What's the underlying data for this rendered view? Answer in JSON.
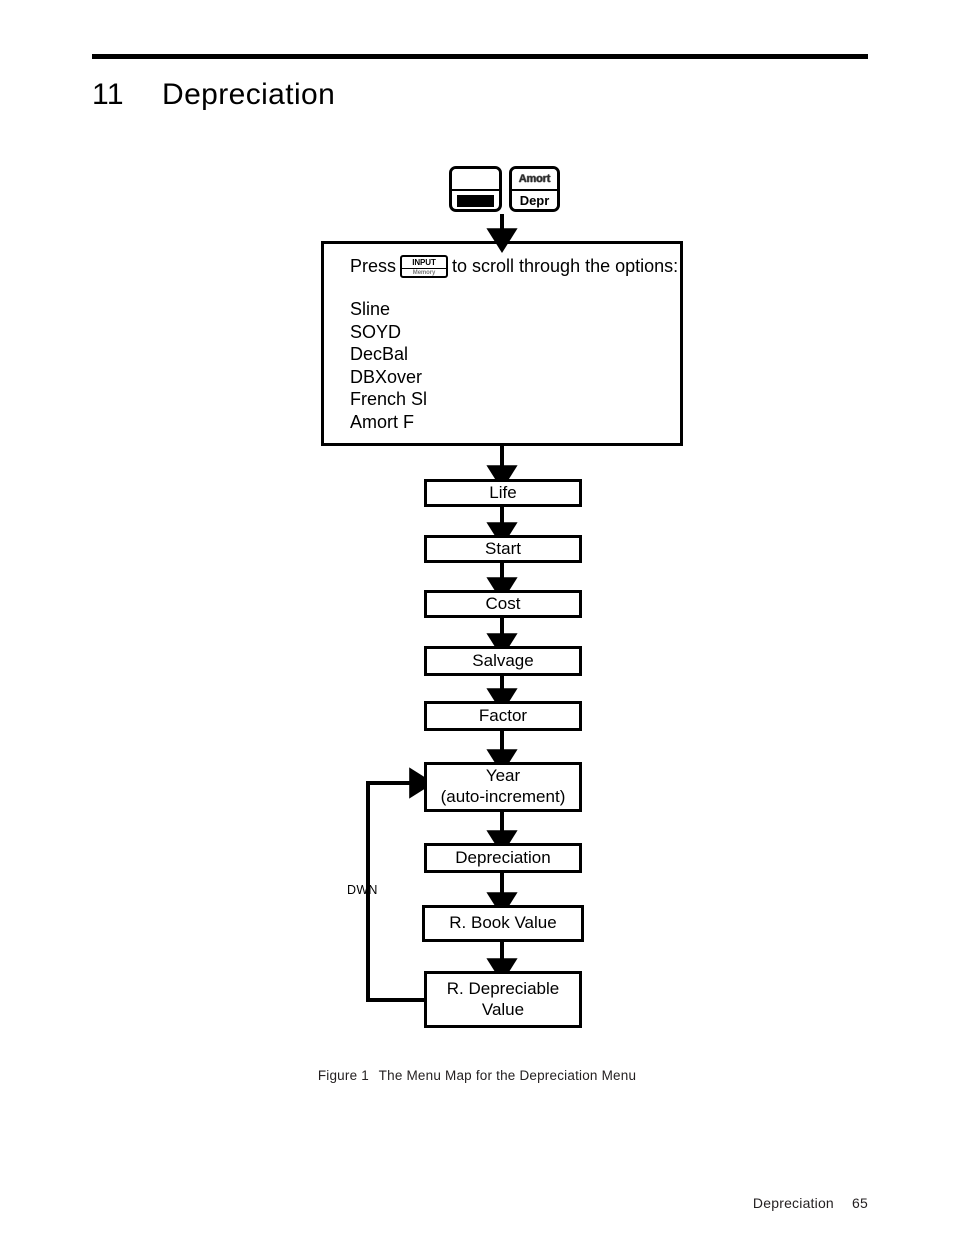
{
  "chapter": {
    "number": "11",
    "title": "Depreciation"
  },
  "keys": {
    "shift_key": {
      "name": "shift-key",
      "label": ""
    },
    "amort_depr_key": {
      "shifted_label": "Amort",
      "primary_label": "Depr"
    },
    "input_key": {
      "primary_label": "INPUT",
      "shifted_label": "Memory"
    }
  },
  "options_box": {
    "prompt_before": "Press",
    "prompt_after": "to scroll through the options:",
    "options": [
      "Sline",
      "SOYD",
      "DecBal",
      "DBXover",
      "French Sl",
      "Amort F"
    ]
  },
  "flow": {
    "boxes": [
      {
        "id": "life",
        "label": "Life"
      },
      {
        "id": "start",
        "label": "Start"
      },
      {
        "id": "cost",
        "label": "Cost"
      },
      {
        "id": "salvage",
        "label": "Salvage"
      },
      {
        "id": "factor",
        "label": "Factor"
      },
      {
        "id": "year",
        "label": "Year\n(auto-increment)",
        "line1": "Year",
        "line2": "(auto-increment)"
      },
      {
        "id": "depreciation",
        "label": "Depreciation"
      },
      {
        "id": "rbookvalue",
        "label": "R. Book Value"
      },
      {
        "id": "rdepreciable",
        "label": "R. Depreciable Value",
        "line1": "R. Depreciable",
        "line2": "Value"
      }
    ],
    "loop_label": "DWN"
  },
  "figure": {
    "label": "Figure 1",
    "caption": "The Menu Map for the Depreciation Menu"
  },
  "footer": {
    "section": "Depreciation",
    "page_number": "65"
  },
  "colors": {
    "ink": "#000000",
    "caption_ink": "#231f20",
    "paper": "#ffffff"
  }
}
